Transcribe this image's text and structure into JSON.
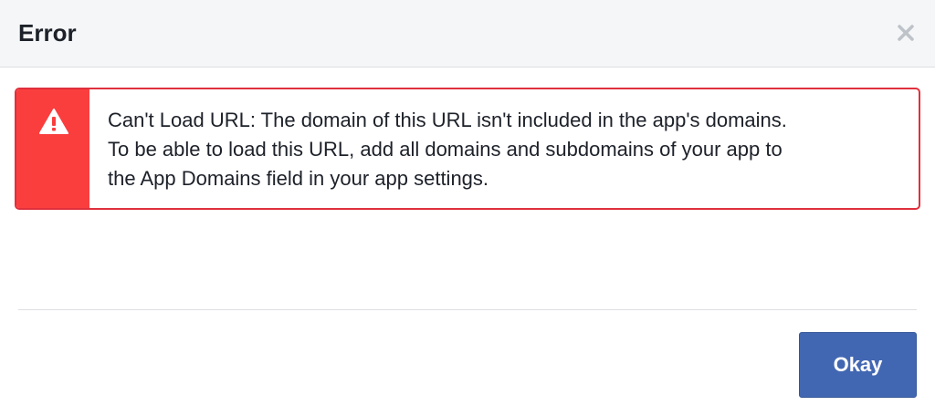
{
  "dialog": {
    "title": "Error"
  },
  "alert": {
    "line1": "Can't Load URL: The domain of this URL isn't included in the app's domains.",
    "line2": "To be able to load this URL, add all domains and subdomains of your app to",
    "line3": "the App Domains field in your app settings.",
    "icon": "warning-icon",
    "color": "#fa3e3e"
  },
  "footer": {
    "okay_label": "Okay",
    "accent": "#4267b2"
  }
}
